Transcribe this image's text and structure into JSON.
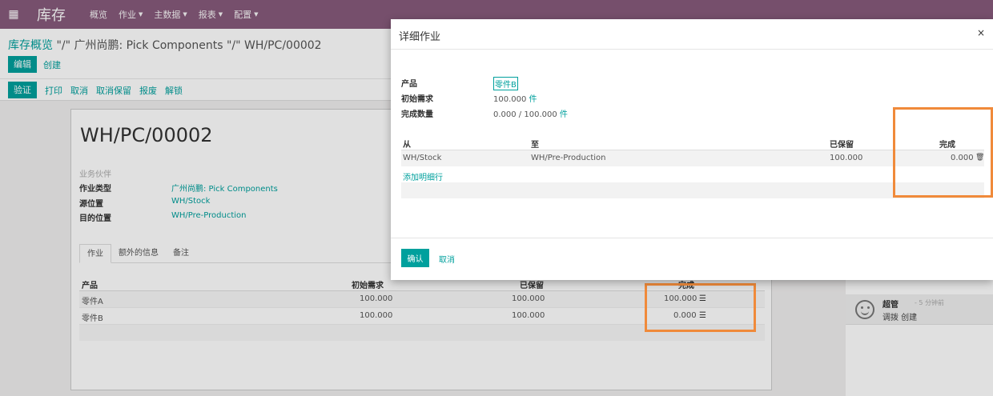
{
  "navbar": {
    "brand": "库存",
    "menu": [
      {
        "label": "概览",
        "caret": false
      },
      {
        "label": "作业",
        "caret": true
      },
      {
        "label": "主数据",
        "caret": true
      },
      {
        "label": "报表",
        "caret": true
      },
      {
        "label": "配置",
        "caret": true
      }
    ]
  },
  "breadcrumb": {
    "root": "库存概览",
    "rest": " \"/\" 广州尚鹏: Pick Components \"/\" WH/PC/00002"
  },
  "buttons": {
    "edit": "编辑",
    "create": "创建"
  },
  "statusbar": {
    "validate": "验证",
    "actions": [
      "打印",
      "取消",
      "取消保留",
      "报废",
      "解锁"
    ]
  },
  "sheet": {
    "title": "WH/PC/00002",
    "fields": [
      {
        "label": "业务伙伴",
        "value": "",
        "muted": true
      },
      {
        "label": "作业类型",
        "value": "广州尚鹏: Pick Components",
        "muted": false
      },
      {
        "label": "源位置",
        "value": "WH/Stock",
        "muted": false
      },
      {
        "label": "目的位置",
        "value": "WH/Pre-Production",
        "muted": false
      }
    ],
    "tabs": [
      "作业",
      "额外的信息",
      "备注"
    ],
    "table": {
      "headers": {
        "product": "产品",
        "demand": "初始需求",
        "reserved": "已保留",
        "done": "完成"
      },
      "rows": [
        {
          "product": "零件A",
          "demand": "100.000",
          "reserved": "100.000",
          "done": "100.000"
        },
        {
          "product": "零件B",
          "demand": "100.000",
          "reserved": "100.000",
          "done": "0.000"
        }
      ]
    }
  },
  "chatter": {
    "author": "超管",
    "time": "- 5 分钟前",
    "text": "调拨 创建"
  },
  "modal": {
    "title": "详细作业",
    "close": "×",
    "product_label": "产品",
    "product_value": "零件B",
    "demand_label": "初始需求",
    "demand_value": "100.000",
    "demand_unit": "件",
    "done_label": "完成数量",
    "done_value": "0.000 / 100.000",
    "done_unit": "件",
    "table": {
      "headers": {
        "from": "从",
        "to": "至",
        "reserved": "已保留",
        "done": "完成"
      },
      "rows": [
        {
          "from": "WH/Stock",
          "to": "WH/Pre-Production",
          "reserved": "100.000",
          "done": "0.000"
        }
      ]
    },
    "add_line": "添加明细行",
    "confirm": "确认",
    "cancel": "取消"
  },
  "colors": {
    "brand": "#875a7b",
    "accent": "#00a09d",
    "highlight": "#f08a3a"
  },
  "icons": [
    "apps-icon",
    "caret-down-icon",
    "list-icon",
    "trash-icon",
    "close-icon",
    "smiley-avatar-icon"
  ]
}
